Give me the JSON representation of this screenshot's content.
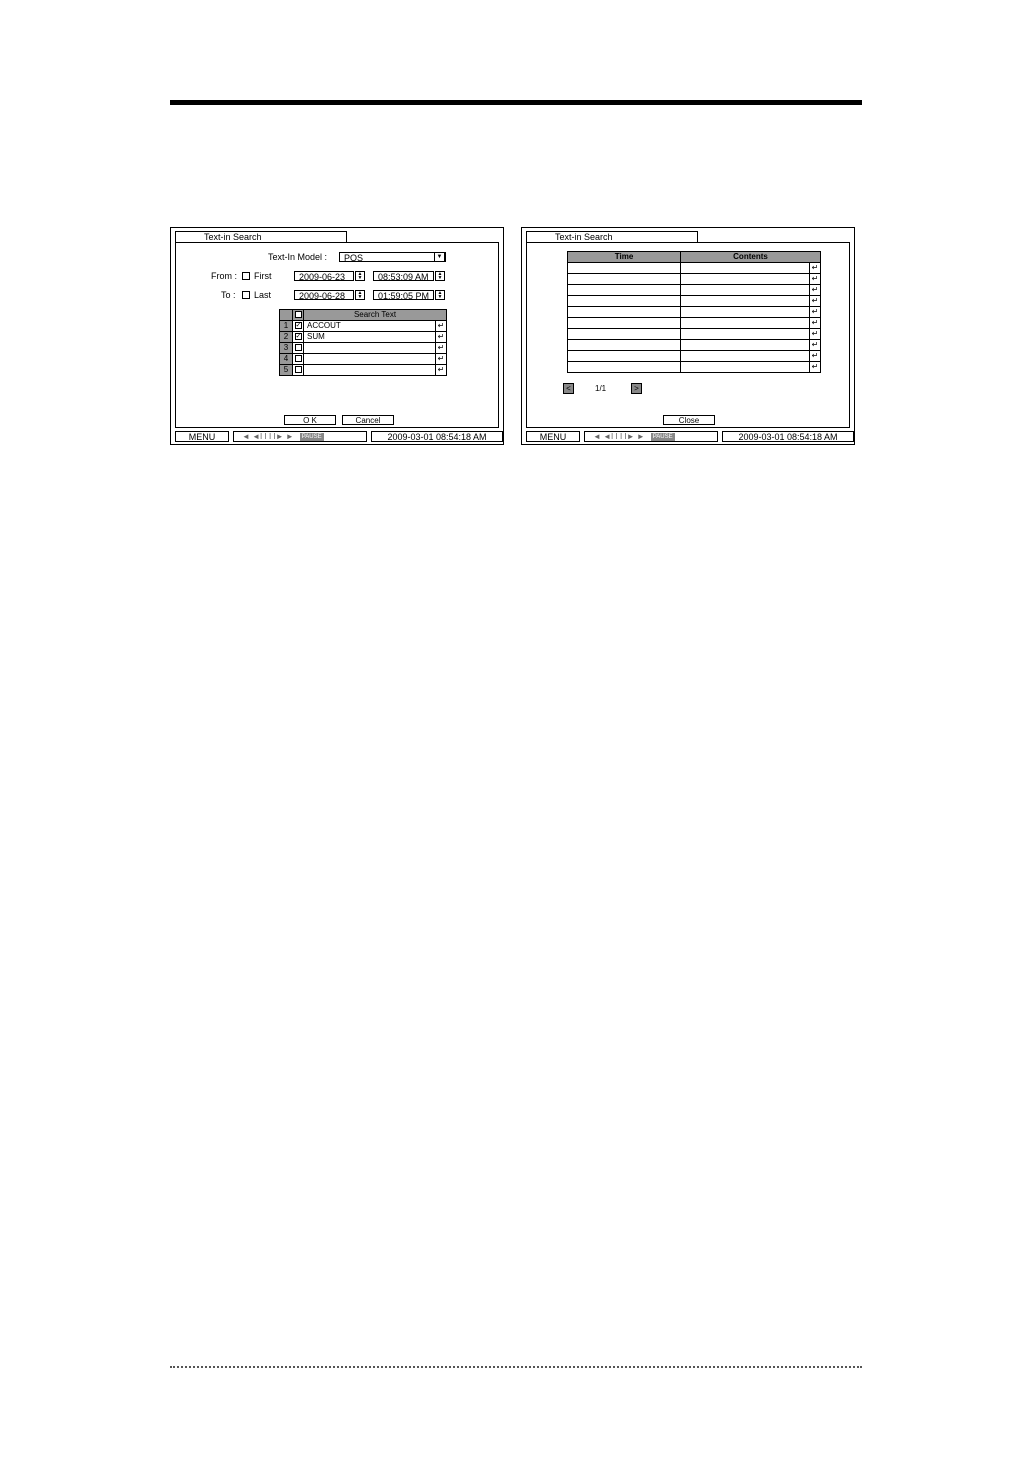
{
  "left_screen": {
    "title": "Text-in Search",
    "model_label": "Text-In Model :",
    "model_value": "POS",
    "from_label": "From :",
    "first_label": "First",
    "from_date": "2009-06-23",
    "from_time": "08:53:09 AM",
    "to_label": "To :",
    "last_label": "Last",
    "to_date": "2009-06-28",
    "to_time": "01:59:05 PM",
    "search_header": "Search Text",
    "rows": [
      {
        "num": "1",
        "checked": "✓",
        "text": "ACCOUT"
      },
      {
        "num": "2",
        "checked": "✓",
        "text": "SUM"
      },
      {
        "num": "3",
        "checked": "",
        "text": ""
      },
      {
        "num": "4",
        "checked": "",
        "text": ""
      },
      {
        "num": "5",
        "checked": "",
        "text": ""
      }
    ],
    "enter_glyph": "↵",
    "ok_label": "O K",
    "cancel_label": "Cancel"
  },
  "right_screen": {
    "title": "Text-in Search",
    "col_time": "Time",
    "col_contents": "Contents",
    "page": "1/1",
    "close_label": "Close"
  },
  "statusbar": {
    "menu_label": "MENU",
    "controls": "◄ ◄I I I I► ►",
    "pause_label": "PAUSE",
    "datetime": "2009-03-01  08:54:18 AM"
  },
  "icons": [
    "dropdown-arrow-icon",
    "spin-icon",
    "checkbox-icon",
    "enter-icon",
    "prev-page-icon",
    "next-page-icon"
  ]
}
